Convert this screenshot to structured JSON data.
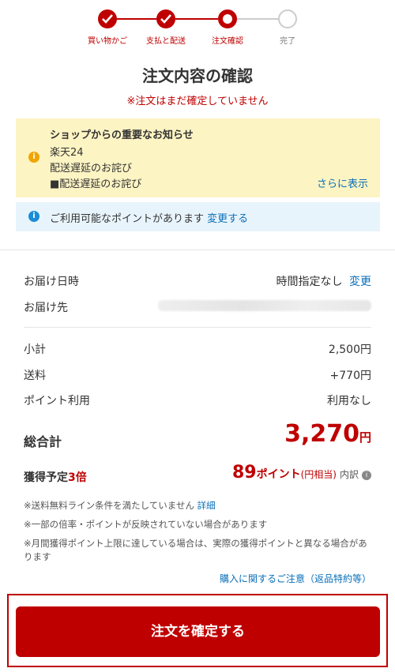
{
  "steps": [
    {
      "label": "買い物かご",
      "state": "done"
    },
    {
      "label": "支払と配送",
      "state": "done"
    },
    {
      "label": "注文確認",
      "state": "current"
    },
    {
      "label": "完了",
      "state": "todo"
    }
  ],
  "page": {
    "title": "注文内容の確認",
    "warning": "※注文はまだ確定していません"
  },
  "shop_notice": {
    "title": "ショップからの重要なお知らせ",
    "lines": [
      "楽天24",
      "配送遅延のお詫び",
      "■配送遅延のお詫び"
    ],
    "more_link": "さらに表示"
  },
  "points_notice": {
    "text": "ご利用可能なポイントがあります",
    "link": "変更する"
  },
  "delivery": {
    "date_label": "お届け日時",
    "date_value": "時間指定なし",
    "date_change": "変更",
    "address_label": "お届け先"
  },
  "summary": {
    "subtotal_label": "小計",
    "subtotal_value": "2,500円",
    "shipping_label": "送料",
    "shipping_value": "+770円",
    "points_use_label": "ポイント利用",
    "points_use_value": "利用なし",
    "total_label": "総合計",
    "total_amount": "3,270",
    "total_unit": "円"
  },
  "earn": {
    "label": "獲得予定",
    "multiplier": "3倍",
    "points": "89",
    "unit": "ポイント",
    "unit_sub": "(円相当)",
    "detail": "内訳"
  },
  "notes": {
    "free_shipping": "※送料無料ライン条件を満たしていません",
    "free_shipping_link": "詳細",
    "multiplier_note": "※一部の倍率・ポイントが反映されていない場合があります",
    "limit_note": "※月間獲得ポイント上限に達している場合は、実際の獲得ポイントと異なる場合があります",
    "purchase_link": "購入に関するご注意（返品特約等）"
  },
  "confirm_button": "注文を確定する",
  "colors": {
    "accent": "#bf0000",
    "link": "#0a6fb8",
    "notice_bg": "#fdf4c3",
    "info_bg": "#e8f4fc"
  }
}
